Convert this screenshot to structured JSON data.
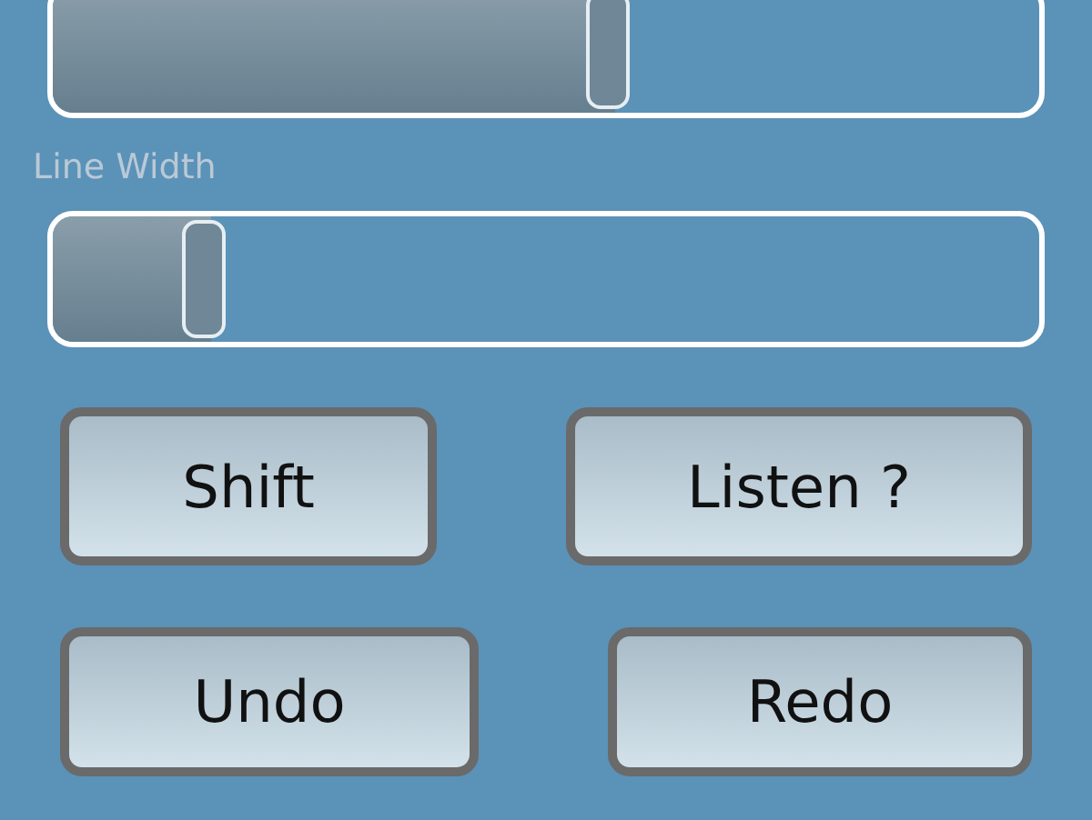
{
  "sliders": [
    {
      "level": 0.57
    },
    {
      "label": "Line Width",
      "level": 0.16
    }
  ],
  "button_rows": [
    [
      "Shift",
      "Listen ?"
    ],
    [
      "Undo",
      "Redo"
    ]
  ]
}
